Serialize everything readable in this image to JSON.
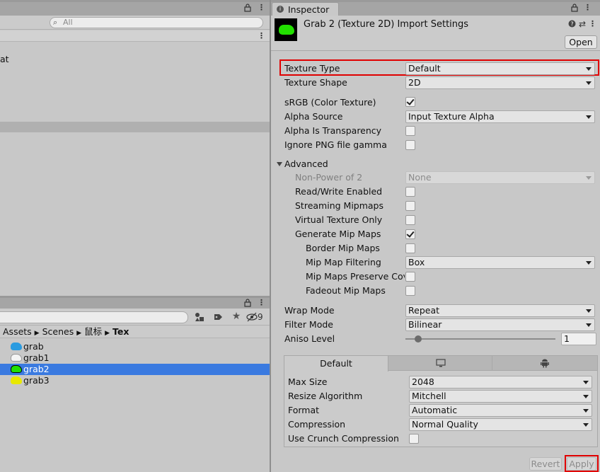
{
  "left_top_panel": {
    "search_placeholder": "All",
    "partial_text": "at"
  },
  "project_panel": {
    "hidden_count": "9",
    "breadcrumb": [
      "Assets",
      "Scenes",
      "鼠标",
      "Tex"
    ],
    "files": [
      {
        "name": "grab",
        "color": "#2a9be0",
        "selected": false
      },
      {
        "name": "grab1",
        "color": "#f4f4f4",
        "selected": false
      },
      {
        "name": "grab2",
        "color": "#22e000",
        "selected": true
      },
      {
        "name": "grab3",
        "color": "#e8e800",
        "selected": false
      }
    ],
    "selection_color": "#3a7ae0"
  },
  "inspector": {
    "tab_label": "Inspector",
    "title": "Grab 2 (Texture 2D) Import Settings",
    "open_button": "Open",
    "texture_type_label": "Texture Type",
    "texture_type_value": "Default",
    "texture_shape_label": "Texture Shape",
    "texture_shape_value": "2D",
    "srgb_label": "sRGB (Color Texture)",
    "alpha_source_label": "Alpha Source",
    "alpha_source_value": "Input Texture Alpha",
    "alpha_transparency_label": "Alpha Is Transparency",
    "ignore_png_label": "Ignore PNG file gamma",
    "advanced_label": "Advanced",
    "npot_label": "Non-Power of 2",
    "npot_value": "None",
    "read_write_label": "Read/Write Enabled",
    "streaming_label": "Streaming Mipmaps",
    "virtual_label": "Virtual Texture Only",
    "gen_mip_label": "Generate Mip Maps",
    "border_mip_label": "Border Mip Maps",
    "mip_filter_label": "Mip Map Filtering",
    "mip_filter_value": "Box",
    "mip_preserve_label": "Mip Maps Preserve Coverage",
    "fadeout_label": "Fadeout Mip Maps",
    "wrap_label": "Wrap Mode",
    "wrap_value": "Repeat",
    "filter_label": "Filter Mode",
    "filter_value": "Bilinear",
    "aniso_label": "Aniso Level",
    "aniso_value": "1",
    "platform_default_tab": "Default",
    "max_size_label": "Max Size",
    "max_size_value": "2048",
    "resize_label": "Resize Algorithm",
    "resize_value": "Mitchell",
    "format_label": "Format",
    "format_value": "Automatic",
    "compression_label": "Compression",
    "compression_value": "Normal Quality",
    "crunch_label": "Use Crunch Compression",
    "revert_button": "Revert",
    "apply_button": "Apply",
    "highlight_color": "#e00000"
  }
}
